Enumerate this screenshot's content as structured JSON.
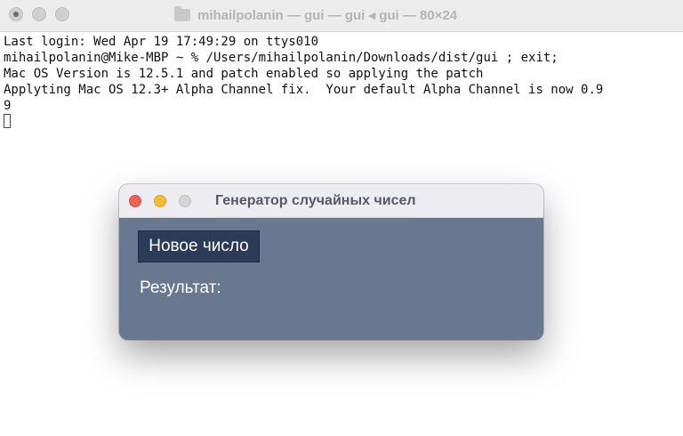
{
  "terminal": {
    "title": "mihailpolanin — gui — gui ◂ gui — 80×24",
    "lines": [
      "Last login: Wed Apr 19 17:49:29 on ttys010",
      "mihailpolanin@Mike-MBP ~ % /Users/mihailpolanin/Downloads/dist/gui ; exit;",
      "Mac OS Version is 12.5.1 and patch enabled so applying the patch",
      "Applyting Mac OS 12.3+ Alpha Channel fix.  Your default Alpha Channel is now 0.9",
      "9"
    ],
    "icon": "folder-icon"
  },
  "app": {
    "title": "Генератор случайных чисел",
    "button_label": "Новое число",
    "result_label": "Результат:",
    "colors": {
      "background": "#677890",
      "button": "#2c3b58"
    }
  }
}
